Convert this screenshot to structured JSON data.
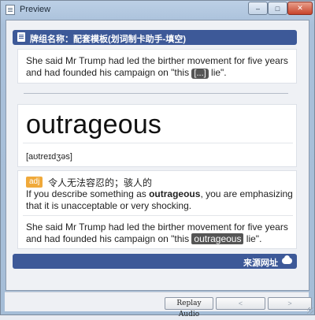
{
  "window": {
    "title": "Preview",
    "minimize_glyph": "–",
    "maximize_glyph": "□",
    "close_glyph": "✕"
  },
  "header": {
    "deck_title": "牌组名称：配套模板(划词制卡助手-填空)"
  },
  "front": {
    "sentence_before": "She said Mr Trump had led the birther movement for five years and had founded his campaign on \"this ",
    "cloze": "[...]",
    "sentence_after": " lie\"."
  },
  "word": {
    "headword": "outrageous",
    "phonetic": "[aʊtreɪdʒəs]"
  },
  "definition": {
    "pos": "adj",
    "chinese": "令人无法容忍的；骇人的",
    "english_before": "If you describe something as ",
    "english_bold": "outrageous",
    "english_after": ", you are emphasizing that it is unacceptable or very shocking."
  },
  "example": {
    "sentence_before": "She said Mr Trump had led the birther movement for five years and had founded his campaign on \"this ",
    "highlight": "outrageous",
    "sentence_after": " lie\"."
  },
  "footer": {
    "source_label": "来源网址"
  },
  "toolbar": {
    "replay_audio": "Replay Audio",
    "prev_glyph": "<",
    "next_glyph": ">"
  },
  "icons": [
    "app-icon",
    "document-icon",
    "cloud-icon",
    "resize-grip-icon"
  ],
  "colors": {
    "bar": "#3d5998",
    "pos_badge": "#f0a93a",
    "cloze_bg": "#555555"
  }
}
